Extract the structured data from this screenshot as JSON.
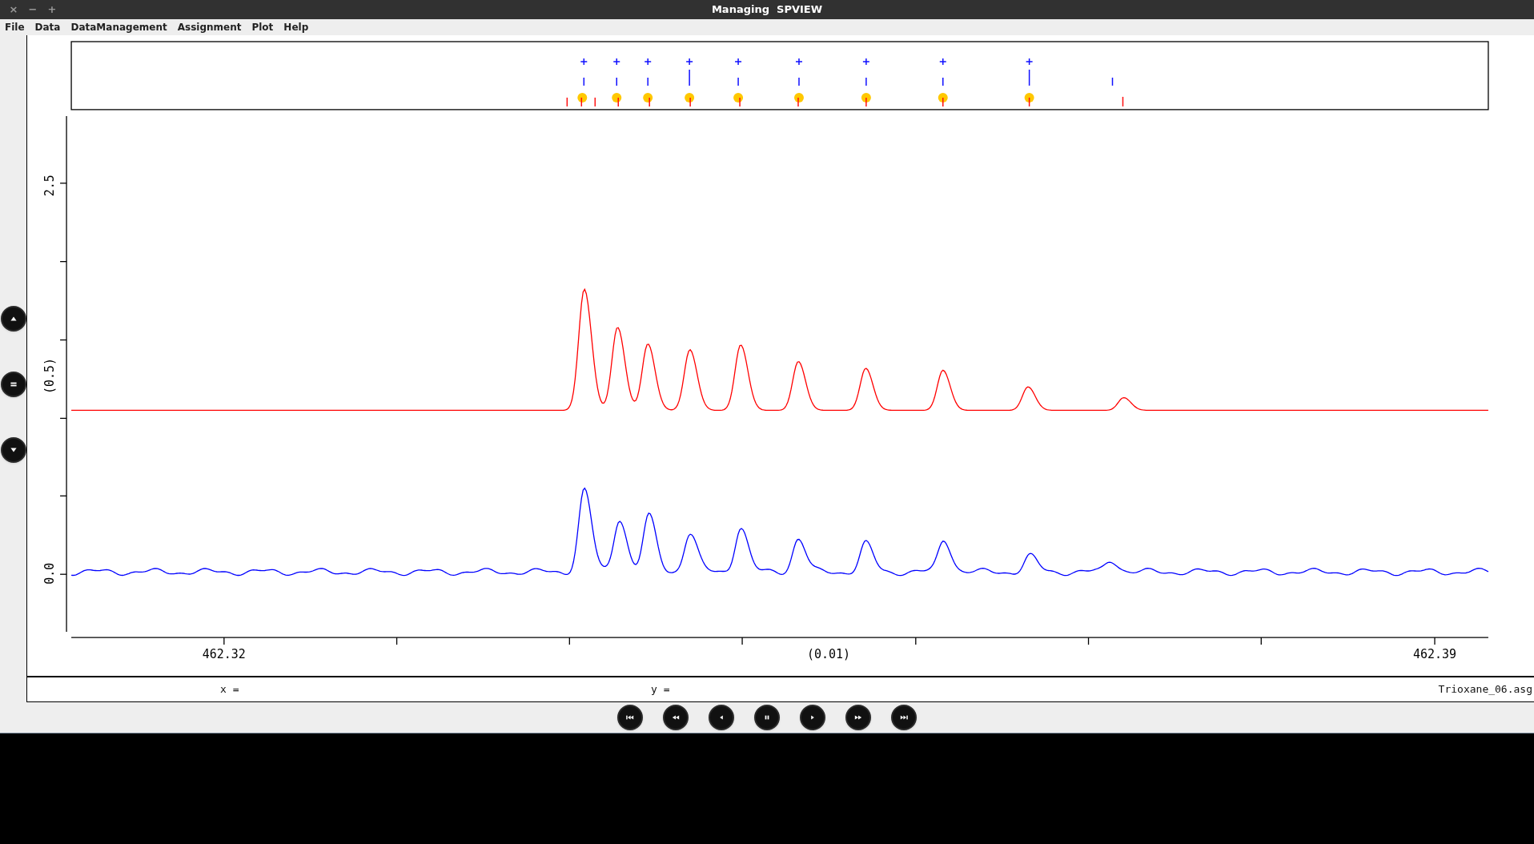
{
  "window": {
    "title": "Managing  SPVIEW",
    "controls": [
      "×",
      "−",
      "+"
    ]
  },
  "menu": [
    "File",
    "Data",
    "DataManagement",
    "Assignment",
    "Plot",
    "Help"
  ],
  "plot": {
    "y_ticks": [
      "2.5",
      "(0.5)",
      "0.0"
    ],
    "x_ticks": [
      "462.32",
      "(0.01)",
      "462.39"
    ]
  },
  "status_bar": {
    "x_label": "x =",
    "y_label": "y =",
    "file": "Trioxane_06.asg"
  }
}
